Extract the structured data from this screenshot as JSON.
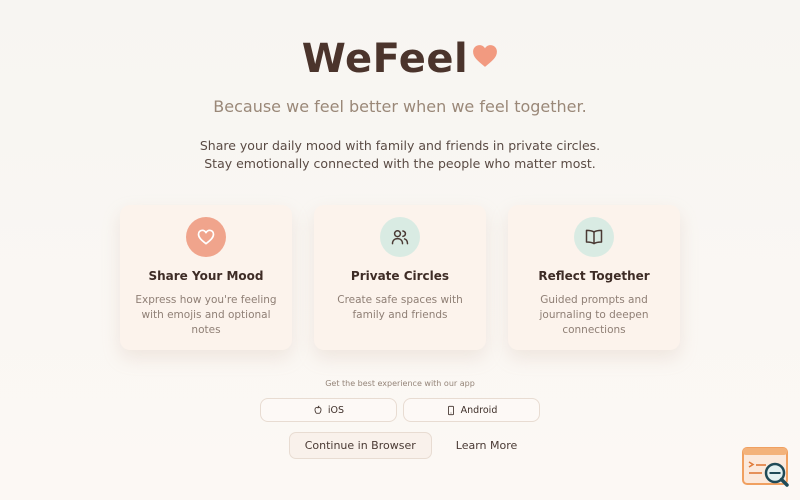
{
  "brand": {
    "title": "WeFeel",
    "heart_color": "#f29a80"
  },
  "tagline": "Because we feel better when we feel together.",
  "description": "Share your daily mood with family and friends in private circles. Stay emotionally connected with the people who matter most.",
  "features": [
    {
      "icon": "heart-icon",
      "icon_bg": "#f0a48c",
      "title": "Share Your Mood",
      "text": "Express how you're feeling with emojis and optional notes"
    },
    {
      "icon": "users-icon",
      "icon_bg": "#d9ebe3",
      "title": "Private Circles",
      "text": "Create safe spaces with family and friends"
    },
    {
      "icon": "book-open-icon",
      "icon_bg": "#d9ebe3",
      "title": "Reflect Together",
      "text": "Guided prompts and journaling to deepen connections"
    }
  ],
  "app_note": "Get the best experience with our app",
  "store_buttons": {
    "ios_label": "iOS",
    "android_label": "Android"
  },
  "cta": {
    "browser_label": "Continue in Browser",
    "learn_label": "Learn More"
  }
}
